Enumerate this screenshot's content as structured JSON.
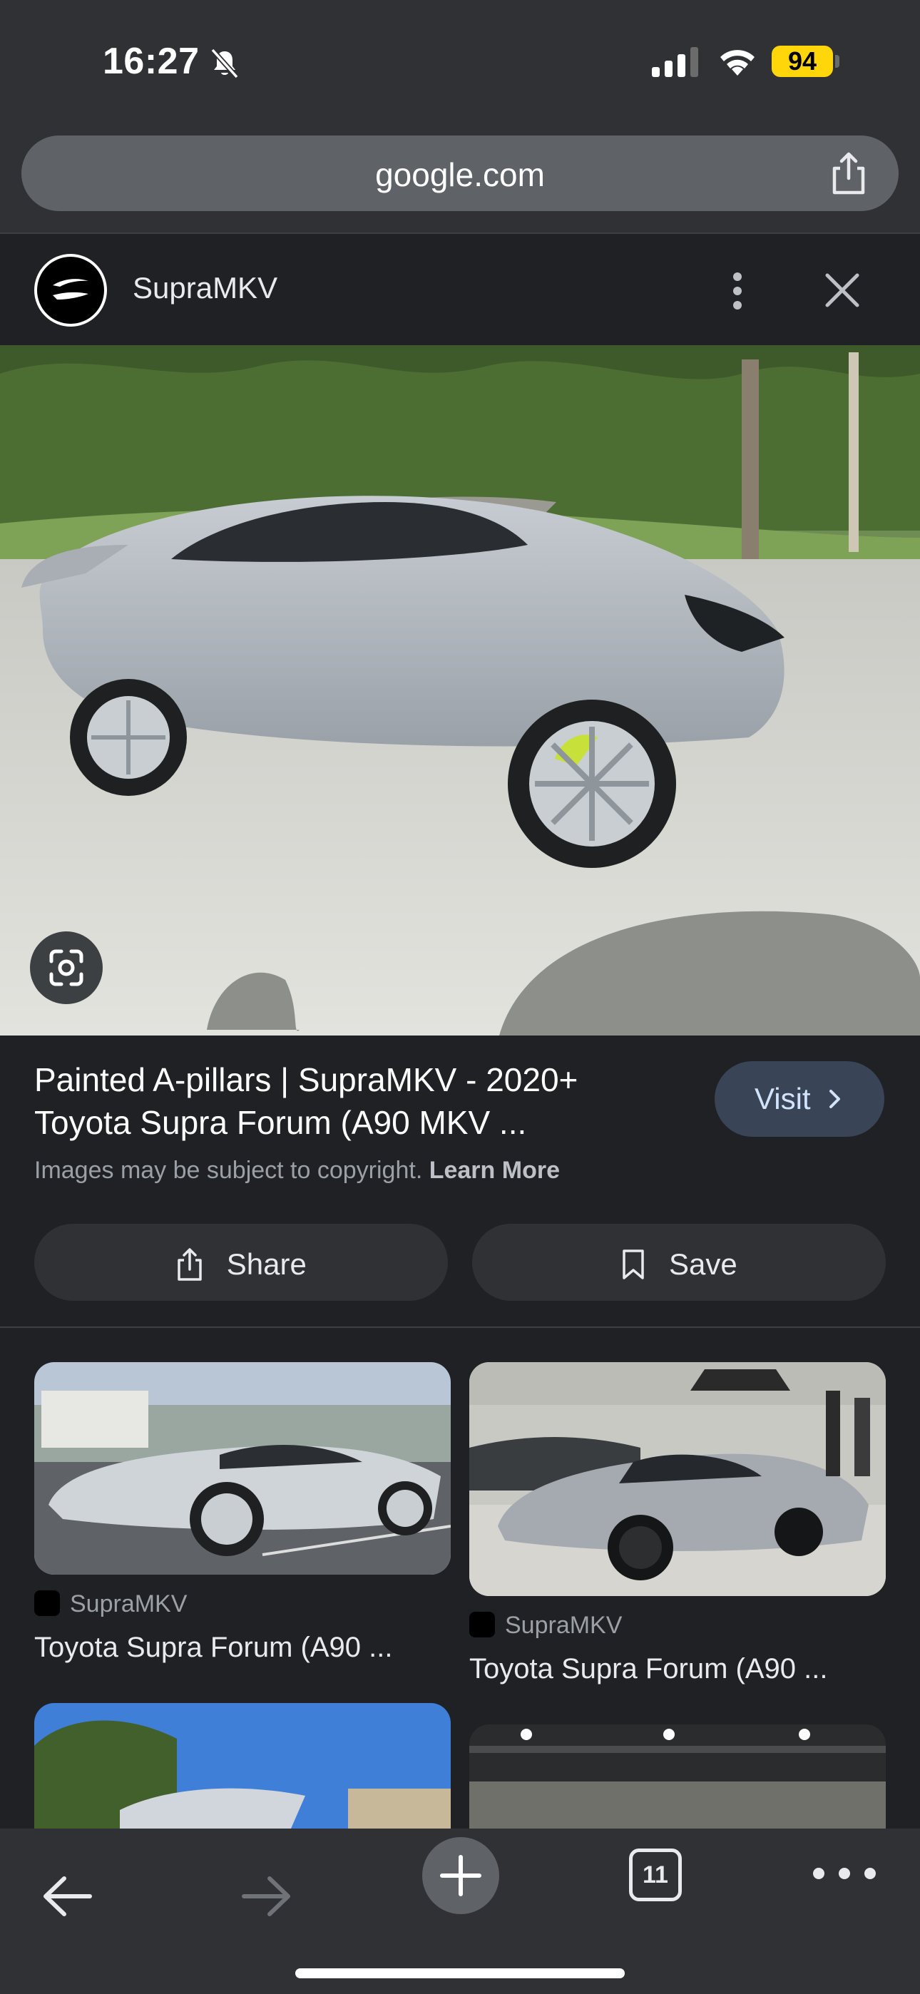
{
  "status_bar": {
    "time": "16:27",
    "battery": "94",
    "icons": [
      "bell-slash-icon",
      "cellular-signal-icon",
      "wifi-icon",
      "battery-icon"
    ]
  },
  "url_bar": {
    "url": "google.com",
    "share_icon": "share-icon"
  },
  "source": {
    "name": "SupraMKV",
    "icons": [
      "more-vertical-icon",
      "close-icon"
    ]
  },
  "result": {
    "title": "Painted A-pillars | SupraMKV - 2020+ Toyota Supra Forum (A90 MKV ...",
    "visit_label": "Visit",
    "copyright_text": "Images may be subject to copyright.",
    "learn_more": "Learn More",
    "share_label": "Share",
    "save_label": "Save"
  },
  "related": [
    {
      "source": "SupraMKV",
      "title": "Toyota Supra Forum (A90 ..."
    },
    {
      "source": "SupraMKV",
      "title": "Toyota Supra Forum (A90 ..."
    }
  ],
  "toolbar": {
    "tab_count": "11",
    "icons": [
      "back-arrow-icon",
      "forward-arrow-icon",
      "plus-icon",
      "tabs-icon",
      "more-horizontal-icon"
    ]
  },
  "colors": {
    "background": "#202124",
    "chrome": "#303134",
    "battery": "#ffd60a",
    "visit_button": "#394457"
  }
}
